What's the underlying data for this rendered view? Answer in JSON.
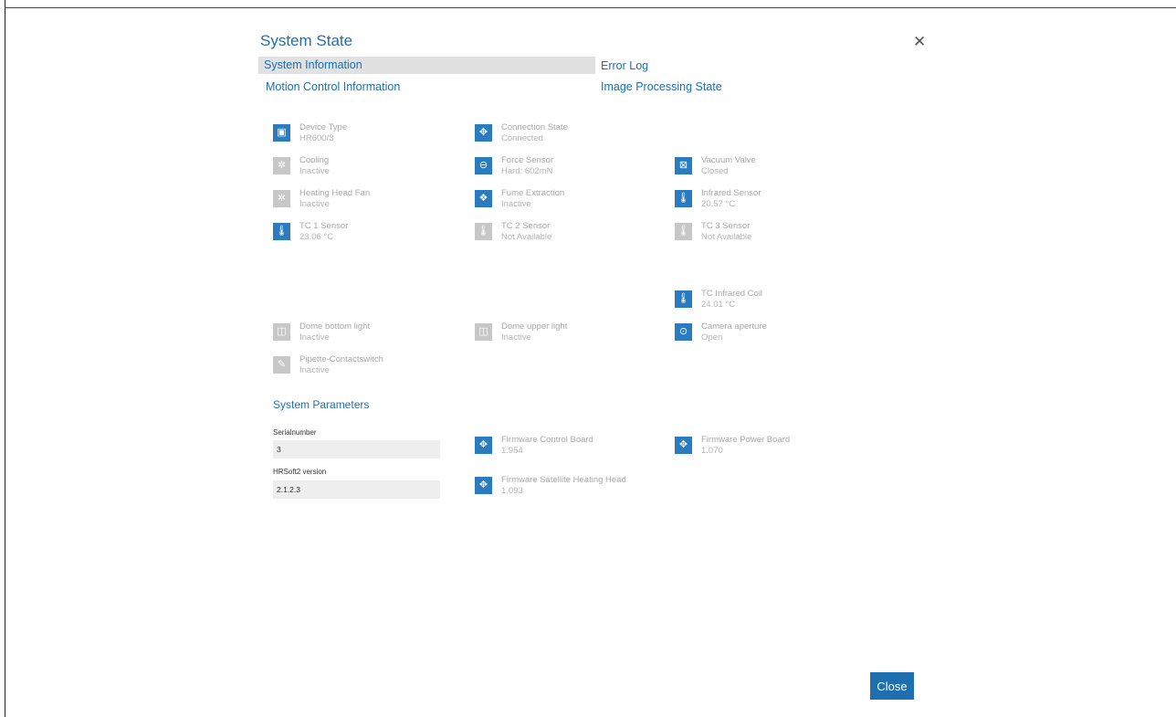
{
  "dialog": {
    "title": "System State",
    "close_label": "Close"
  },
  "nav": {
    "system_information": "System Information",
    "error_log": "Error Log",
    "motion_control_information": "Motion Control Information",
    "image_processing_state": "Image Processing State"
  },
  "colors": {
    "accent": "#1e6fb0",
    "icon_active": "#2b7bc0",
    "icon_inactive": "#c7c7c7",
    "nav_selected_bg": "#e1e1e1"
  },
  "items": {
    "device_type": {
      "label": "Device Type",
      "value": "HR600/3",
      "icon": "device-icon",
      "active": true
    },
    "connection_state": {
      "label": "Connection State",
      "value": "Connected",
      "icon": "connection-icon",
      "active": true
    },
    "cooling": {
      "label": "Cooling",
      "value": "Inactive",
      "icon": "fan-icon",
      "active": false
    },
    "force_sensor": {
      "label": "Force Sensor",
      "value": "Hard: 602mN",
      "icon": "force-icon",
      "active": true
    },
    "vacuum_valve": {
      "label": "Vacuum Valve",
      "value": "Closed",
      "icon": "valve-icon",
      "active": true
    },
    "heating_head_fan": {
      "label": "Heating Head Fan",
      "value": "Inactive",
      "icon": "fan-icon",
      "active": false
    },
    "fume_extraction": {
      "label": "Fume Extraction",
      "value": "Inactive",
      "icon": "extraction-icon",
      "active": true
    },
    "infrared_sensor": {
      "label": "Infrared Sensor",
      "value": "20.57 °C",
      "icon": "thermometer-icon",
      "active": true
    },
    "tc1_sensor": {
      "label": "TC 1 Sensor",
      "value": "23.06 °C",
      "icon": "thermometer-icon",
      "active": true
    },
    "tc2_sensor": {
      "label": "TC 2 Sensor",
      "value": "Not Available",
      "icon": "thermometer-icon",
      "active": false
    },
    "tc3_sensor": {
      "label": "TC 3 Sensor",
      "value": "Not Available",
      "icon": "thermometer-icon",
      "active": false
    },
    "tc_infrared_coil": {
      "label": "TC Infrared Coil",
      "value": "24.01 °C",
      "icon": "thermometer-icon",
      "active": true
    },
    "dome_bottom_light": {
      "label": "Dome bottom light",
      "value": "Inactive",
      "icon": "light-icon",
      "active": false
    },
    "dome_upper_light": {
      "label": "Dome upper light",
      "value": "Inactive",
      "icon": "light-icon",
      "active": false
    },
    "camera_aperture": {
      "label": "Camera aperture",
      "value": "Open",
      "icon": "aperture-icon",
      "active": true
    },
    "pipette_contactswitch": {
      "label": "Pipette-Contactswitch",
      "value": "Inactive",
      "icon": "pipette-icon",
      "active": false
    },
    "fw_control_board": {
      "label": "Firmware Control Board",
      "value": "1.954",
      "icon": "chip-icon",
      "active": true
    },
    "fw_power_board": {
      "label": "Firmware Power Board",
      "value": "1.070",
      "icon": "chip-icon",
      "active": true
    },
    "fw_satellite_heating_head": {
      "label": "Firmware Satellite Heating Head",
      "value": "1.093",
      "icon": "chip-icon",
      "active": true
    }
  },
  "parameters": {
    "title": "System Parameters",
    "serialnumber_label": "Serialnumber",
    "serialnumber_value": "3",
    "hrsoft_label": "HRSoft2 version",
    "hrsoft_value": "2.1.2.3"
  }
}
